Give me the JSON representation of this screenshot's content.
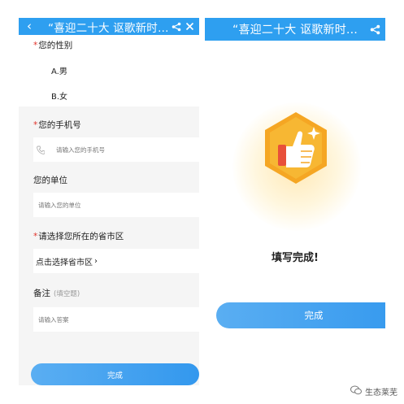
{
  "left_screen": {
    "title": "“喜迎二十大 讴歌新时…",
    "q_gender": "您的性别",
    "gender_options": [
      "A.男",
      "B.女"
    ],
    "q_phone": "您的手机号",
    "phone_placeholder": "请输入您的手机号",
    "q_company": "您的单位",
    "company_placeholder": "请输入您的单位",
    "q_region": "请选择您所在的省市区",
    "region_value": "点击选择省市区",
    "region_chevron": "›",
    "q_note": "备注",
    "q_note_hint": "(填空题)",
    "note_placeholder": "请输入答案",
    "done_label": "完成"
  },
  "right_screen": {
    "title": "“喜迎二十大 讴歌新时…",
    "success_text": "填写完成!",
    "done_label": "完成"
  },
  "watermark": {
    "text": "生态莱芜"
  },
  "colors": {
    "accent": "#2e9ff0",
    "required": "#e0322a",
    "badge": "#f5a623"
  }
}
